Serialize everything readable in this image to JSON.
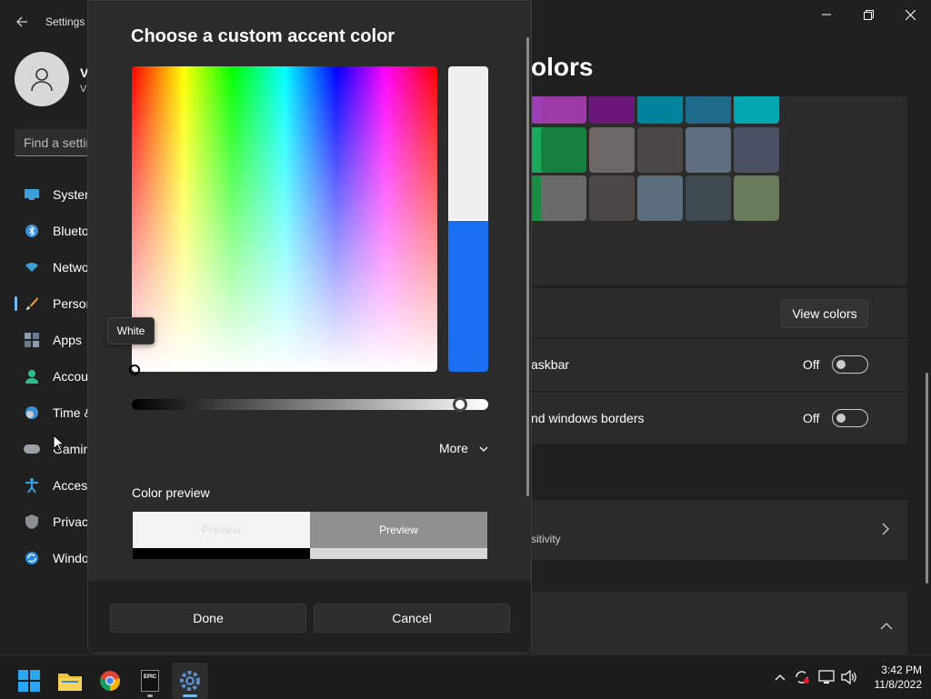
{
  "window": {
    "app_title": "Settings",
    "back_icon": "arrow-left-icon",
    "minimize_icon": "minimize-icon",
    "maximize_icon": "restore-icon",
    "close_icon": "close-icon"
  },
  "sidebar": {
    "user": {
      "name": "V",
      "email": "V"
    },
    "search": {
      "placeholder": "Find a setting"
    },
    "items": [
      {
        "label": "System",
        "icon": "monitor-icon",
        "active": false
      },
      {
        "label": "Bluetooth & devices",
        "icon": "bluetooth-icon",
        "active": false
      },
      {
        "label": "Network & internet",
        "icon": "wifi-icon",
        "active": false
      },
      {
        "label": "Personalization",
        "icon": "paintbrush-icon",
        "active": true
      },
      {
        "label": "Apps",
        "icon": "apps-icon",
        "active": false
      },
      {
        "label": "Accounts",
        "icon": "account-icon",
        "active": false
      },
      {
        "label": "Time & language",
        "icon": "clock-globe-icon",
        "active": false
      },
      {
        "label": "Gaming",
        "icon": "gamepad-icon",
        "active": false
      },
      {
        "label": "Accessibility",
        "icon": "accessibility-icon",
        "active": false
      },
      {
        "label": "Privacy & security",
        "icon": "shield-icon",
        "active": false
      },
      {
        "label": "Windows Update",
        "icon": "update-icon",
        "active": false
      }
    ]
  },
  "main": {
    "heading": "olors",
    "swatch_colors": [
      [
        "#9a3fb4",
        "#9c3aa8",
        "#6b1679",
        "#00849b",
        "#1e6a8b",
        "#00a7b0"
      ],
      [
        "#1aa85a",
        "#16803e",
        "#6c6664",
        "#4a4846",
        "#5e6d80",
        "#4b5163"
      ],
      [
        "#1a8d44",
        "#6a6a6a",
        "#4b4745",
        "#5b6d7b",
        "#3e4a50",
        "#6a7a5c"
      ]
    ],
    "view_colors_label": "View colors",
    "taskbar_row": {
      "label": "askbar",
      "state": "Off"
    },
    "borders_row": {
      "label": "nd windows borders",
      "state": "Off"
    },
    "contrast_row": {
      "label": "sitivity"
    }
  },
  "dialog": {
    "title": "Choose a custom accent color",
    "tooltip": "White",
    "selected_color": "#1a6ff0",
    "current_color": "#efefef",
    "value_level_percent": 92,
    "more_label": "More",
    "color_preview_label": "Color preview",
    "preview_light_text": "Preview",
    "preview_gray_text": "Preview",
    "done_label": "Done",
    "cancel_label": "Cancel"
  },
  "taskbar": {
    "apps": [
      {
        "name": "start",
        "icon": "windows-logo-icon"
      },
      {
        "name": "file-explorer",
        "icon": "folder-icon"
      },
      {
        "name": "chrome",
        "icon": "chrome-icon"
      },
      {
        "name": "epic-games",
        "icon": "epic-games-icon",
        "label": "EPIC"
      },
      {
        "name": "settings",
        "icon": "gear-icon"
      }
    ],
    "tray": [
      "chevron-up-icon",
      "sync-icon",
      "network-icon",
      "volume-icon"
    ],
    "time": "3:42 PM",
    "date": "11/8/2022"
  }
}
